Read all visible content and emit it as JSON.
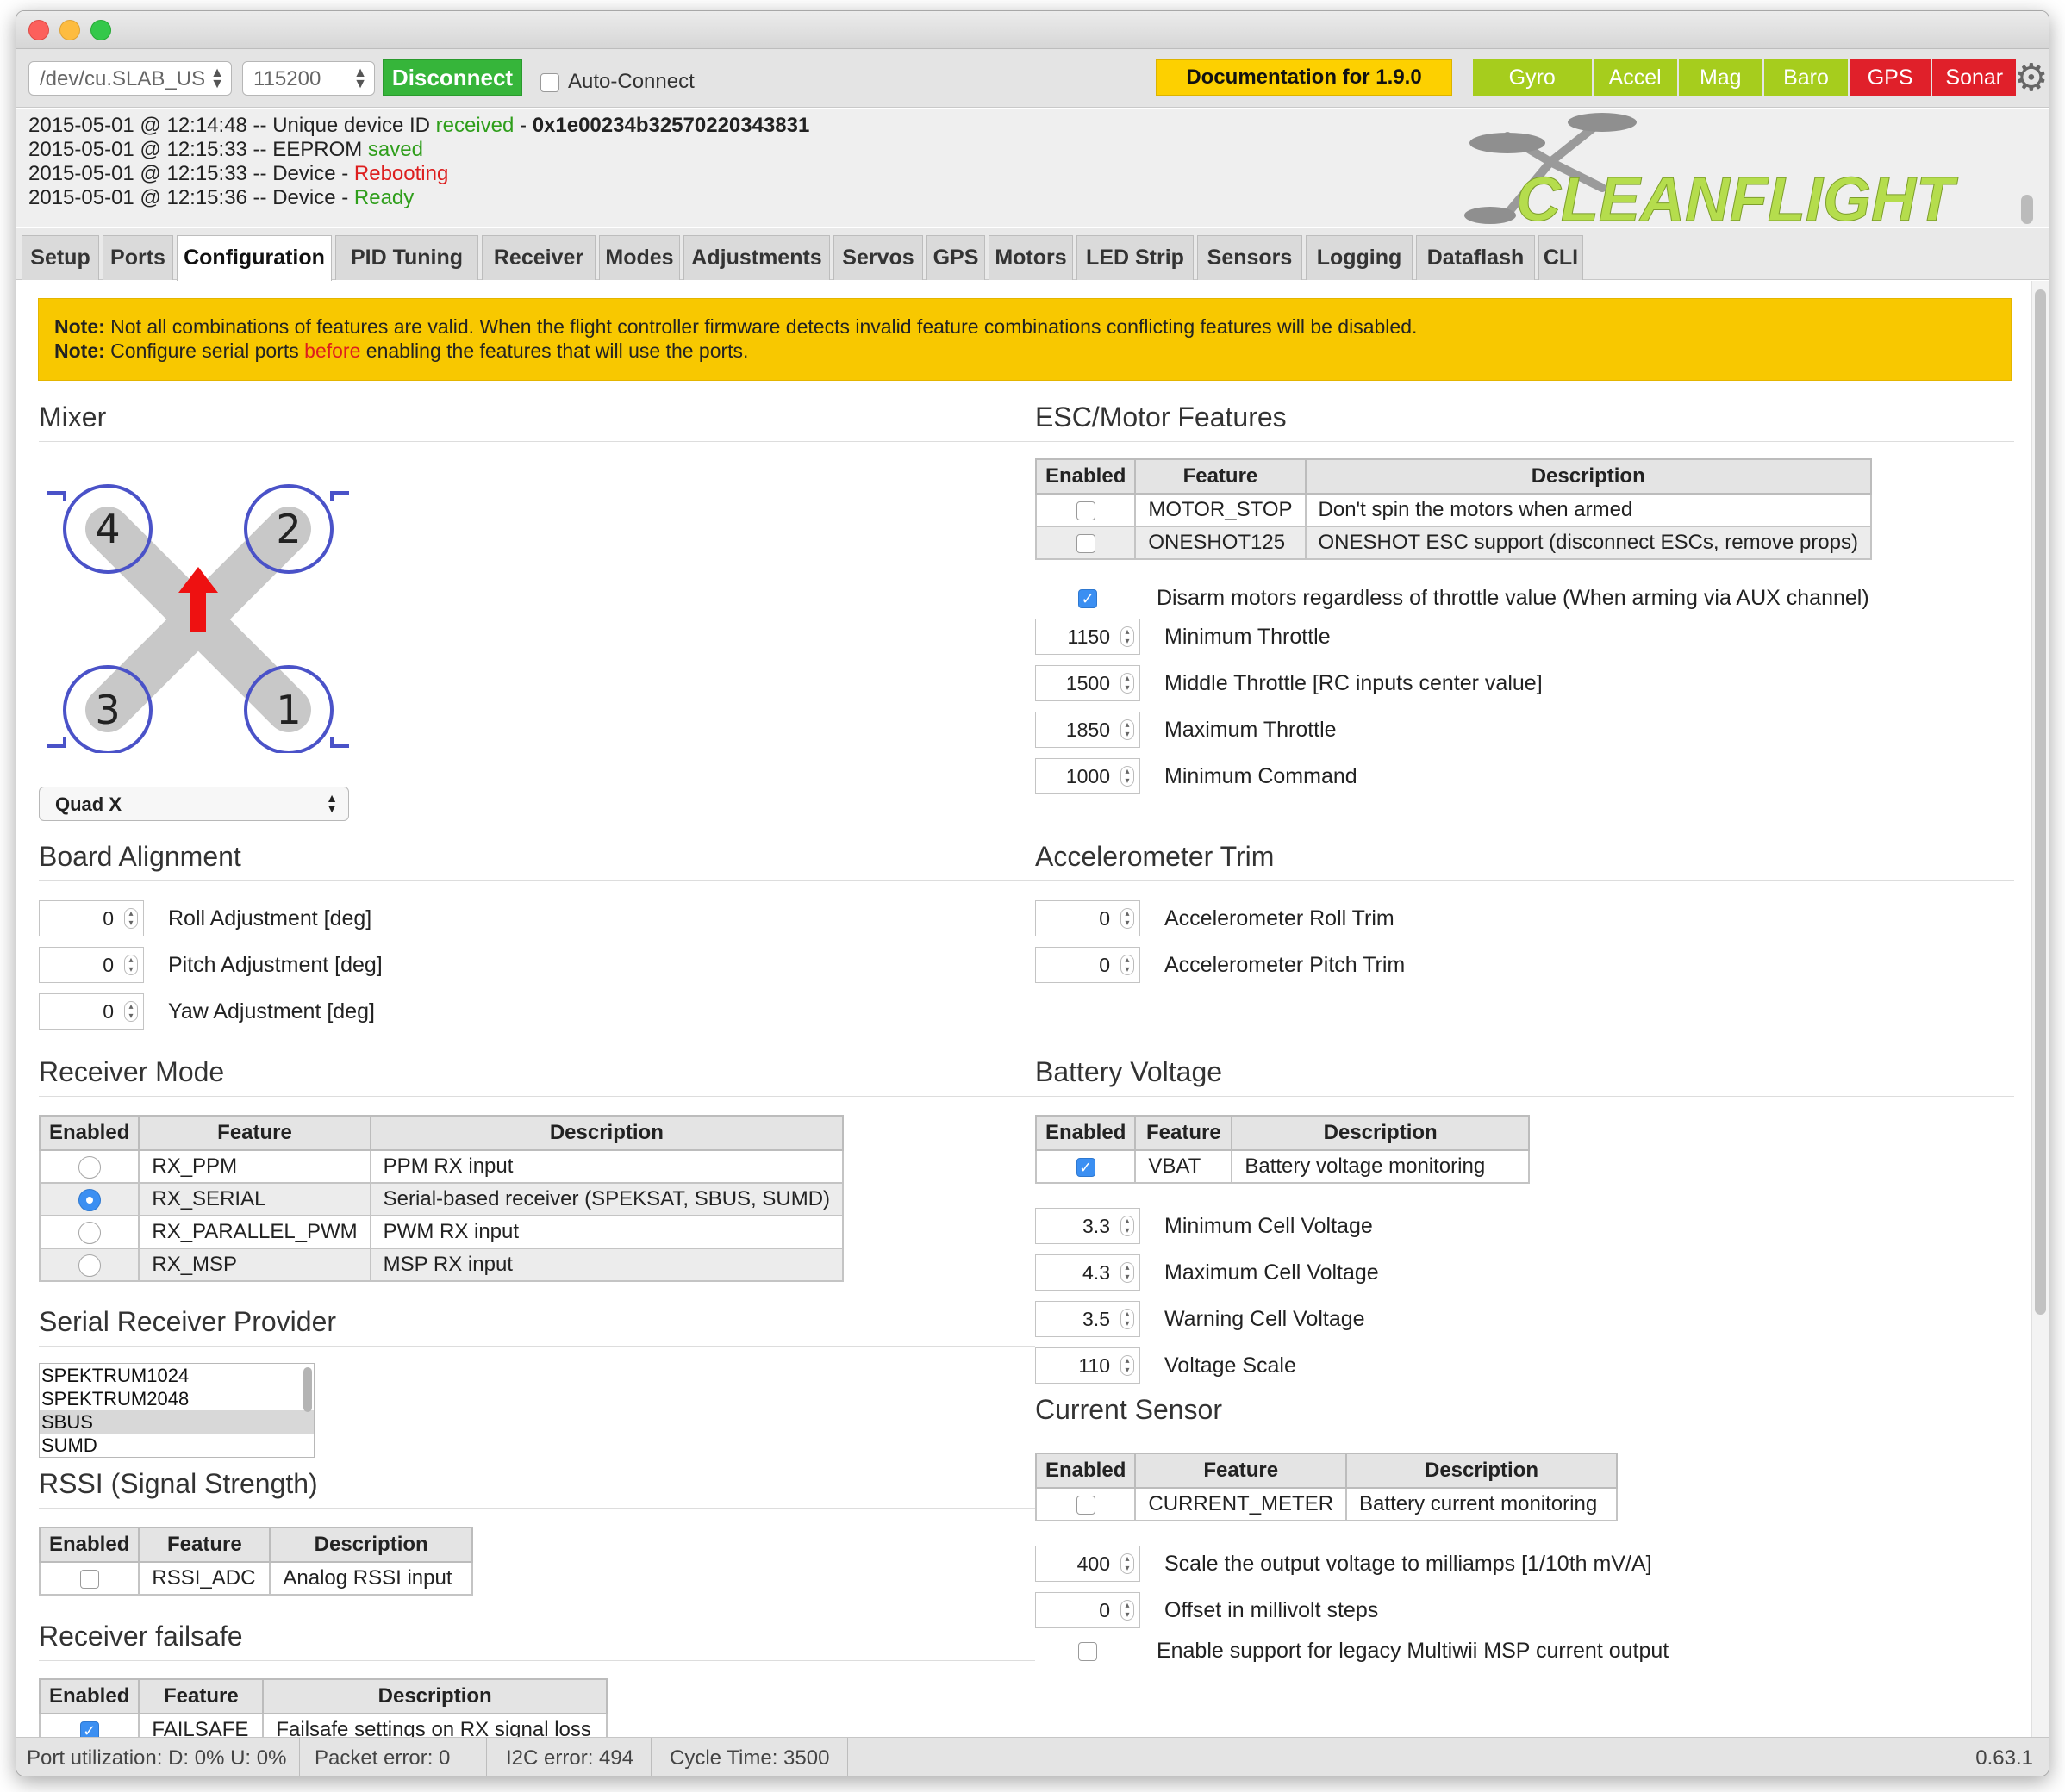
{
  "toolbar": {
    "port": "/dev/cu.SLAB_US",
    "baud": "115200",
    "connect_label": "Disconnect",
    "auto_connect_label": "Auto-Connect",
    "documentation_label": "Documentation for 1.9.0",
    "sensors": [
      {
        "name": "Gyro",
        "status": "ok"
      },
      {
        "name": "Accel",
        "status": "ok"
      },
      {
        "name": "Mag",
        "status": "ok"
      },
      {
        "name": "Baro",
        "status": "ok"
      },
      {
        "name": "GPS",
        "status": "bad"
      },
      {
        "name": "Sonar",
        "status": "bad"
      }
    ]
  },
  "log": {
    "lines": [
      {
        "prefix": "2015-05-01 @ 12:14:48 -- Unique device ID ",
        "highlight": "received",
        "highlight_color": "green",
        "suffix": " - ",
        "bold": "0x1e00234b32570220343831"
      },
      {
        "prefix": "2015-05-01 @ 12:15:33 -- EEPROM ",
        "highlight": "saved",
        "highlight_color": "green",
        "suffix": "",
        "bold": ""
      },
      {
        "prefix": "2015-05-01 @ 12:15:33 -- Device - ",
        "highlight": "Rebooting",
        "highlight_color": "red",
        "suffix": "",
        "bold": ""
      },
      {
        "prefix": "2015-05-01 @ 12:15:36 -- Device - ",
        "highlight": "Ready",
        "highlight_color": "green",
        "suffix": "",
        "bold": ""
      }
    ],
    "logo_text": "CLEANFLIGHT"
  },
  "tabs": [
    {
      "label": "Setup",
      "active": false
    },
    {
      "label": "Ports",
      "active": false
    },
    {
      "label": "Configuration",
      "active": true
    },
    {
      "label": "PID Tuning",
      "active": false
    },
    {
      "label": "Receiver",
      "active": false
    },
    {
      "label": "Modes",
      "active": false
    },
    {
      "label": "Adjustments",
      "active": false
    },
    {
      "label": "Servos",
      "active": false
    },
    {
      "label": "GPS",
      "active": false
    },
    {
      "label": "Motors",
      "active": false
    },
    {
      "label": "LED Strip",
      "active": false
    },
    {
      "label": "Sensors",
      "active": false
    },
    {
      "label": "Logging",
      "active": false
    },
    {
      "label": "Dataflash",
      "active": false
    },
    {
      "label": "CLI",
      "active": false
    }
  ],
  "note": {
    "label": "Note:",
    "line1": "Not all combinations of features are valid. When the flight controller firmware detects invalid feature combinations conflicting features will be disabled.",
    "line2_pre": "Configure serial ports ",
    "line2_red": "before",
    "line2_post": " enabling the features that will use the ports."
  },
  "mixer": {
    "title": "Mixer",
    "motor_numbers": [
      "4",
      "2",
      "3",
      "1"
    ],
    "selected": "Quad X"
  },
  "board_alignment": {
    "title": "Board Alignment",
    "fields": [
      {
        "value": "0",
        "label": "Roll Adjustment [deg]"
      },
      {
        "value": "0",
        "label": "Pitch Adjustment [deg]"
      },
      {
        "value": "0",
        "label": "Yaw Adjustment [deg]"
      }
    ]
  },
  "receiver_mode": {
    "title": "Receiver Mode",
    "headers": [
      "Enabled",
      "Feature",
      "Description"
    ],
    "rows": [
      {
        "selected": false,
        "feature": "RX_PPM",
        "description": "PPM RX input"
      },
      {
        "selected": true,
        "feature": "RX_SERIAL",
        "description": "Serial-based receiver (SPEKSAT, SBUS, SUMD)"
      },
      {
        "selected": false,
        "feature": "RX_PARALLEL_PWM",
        "description": "PWM RX input"
      },
      {
        "selected": false,
        "feature": "RX_MSP",
        "description": "MSP RX input"
      }
    ]
  },
  "serial_receiver": {
    "title": "Serial Receiver Provider",
    "options": [
      "SPEKTRUM1024",
      "SPEKTRUM2048",
      "SBUS",
      "SUMD"
    ],
    "selected": "SBUS"
  },
  "rssi": {
    "title": "RSSI (Signal Strength)",
    "headers": [
      "Enabled",
      "Feature",
      "Description"
    ],
    "rows": [
      {
        "enabled": false,
        "feature": "RSSI_ADC",
        "description": "Analog RSSI input"
      }
    ]
  },
  "failsafe": {
    "title": "Receiver failsafe",
    "headers": [
      "Enabled",
      "Feature",
      "Description"
    ],
    "rows": [
      {
        "enabled": true,
        "feature": "FAILSAFE",
        "description": "Failsafe settings on RX signal loss"
      }
    ]
  },
  "esc": {
    "title": "ESC/Motor Features",
    "headers": [
      "Enabled",
      "Feature",
      "Description"
    ],
    "rows": [
      {
        "enabled": false,
        "feature": "MOTOR_STOP",
        "description": "Don't spin the motors when armed"
      },
      {
        "enabled": false,
        "feature": "ONESHOT125",
        "description": "ONESHOT ESC support (disconnect ESCs, remove props)"
      }
    ],
    "disarm_label": "Disarm motors regardless of throttle value (When arming via AUX channel)",
    "disarm_checked": true,
    "fields": [
      {
        "value": "1150",
        "label": "Minimum Throttle"
      },
      {
        "value": "1500",
        "label": "Middle Throttle [RC inputs center value]"
      },
      {
        "value": "1850",
        "label": "Maximum Throttle"
      },
      {
        "value": "1000",
        "label": "Minimum Command"
      }
    ]
  },
  "acc_trim": {
    "title": "Accelerometer Trim",
    "fields": [
      {
        "value": "0",
        "label": "Accelerometer Roll Trim"
      },
      {
        "value": "0",
        "label": "Accelerometer Pitch Trim"
      }
    ]
  },
  "battery": {
    "title": "Battery Voltage",
    "headers": [
      "Enabled",
      "Feature",
      "Description"
    ],
    "rows": [
      {
        "enabled": true,
        "feature": "VBAT",
        "description": "Battery voltage monitoring"
      }
    ],
    "fields": [
      {
        "value": "3.3",
        "label": "Minimum Cell Voltage"
      },
      {
        "value": "4.3",
        "label": "Maximum Cell Voltage"
      },
      {
        "value": "3.5",
        "label": "Warning Cell Voltage"
      },
      {
        "value": "110",
        "label": "Voltage Scale"
      }
    ]
  },
  "current": {
    "title": "Current Sensor",
    "headers": [
      "Enabled",
      "Feature",
      "Description"
    ],
    "rows": [
      {
        "enabled": false,
        "feature": "CURRENT_METER",
        "description": "Battery current monitoring"
      }
    ],
    "fields": [
      {
        "value": "400",
        "label": "Scale the output voltage to milliamps [1/10th mV/A]"
      },
      {
        "value": "0",
        "label": "Offset in millivolt steps"
      }
    ],
    "legacy_label": "Enable support for legacy Multiwii MSP current output",
    "legacy_checked": false
  },
  "status": {
    "port_util": "Port utilization: D: 0% U: 0%",
    "packet_error": "Packet error: 0",
    "i2c_error": "I2C error: 494",
    "cycle_time": "Cycle Time: 3500",
    "version": "0.63.1"
  },
  "colors": {
    "accent_green": "#36b53a",
    "sensor_ok": "#a6cd1d",
    "sensor_bad": "#e0202a",
    "note_yellow": "#f8c800",
    "docs_yellow": "#fdd000"
  }
}
